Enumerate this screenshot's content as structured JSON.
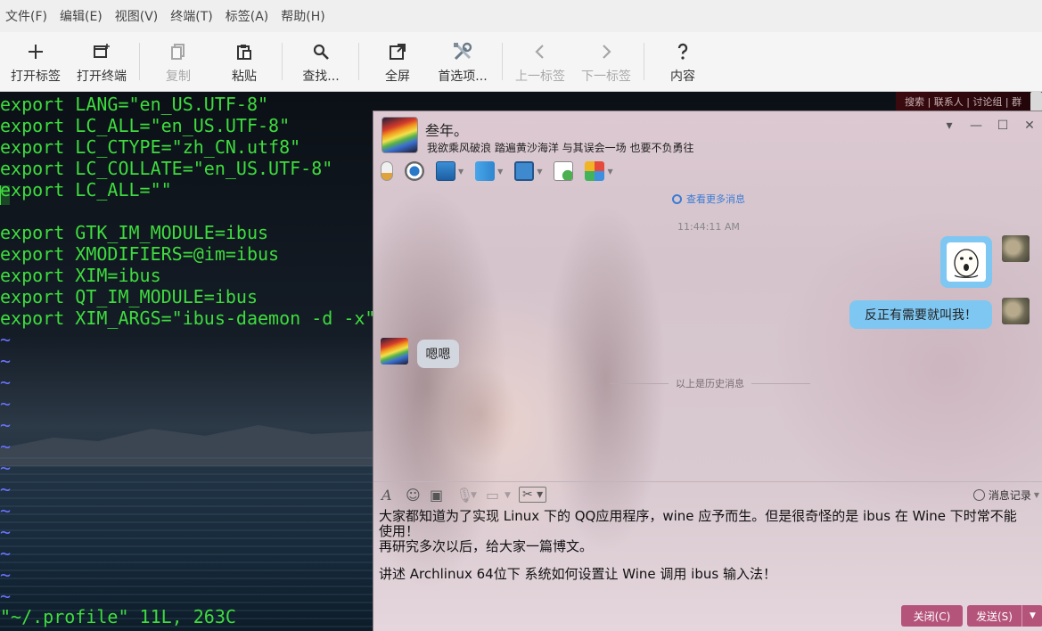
{
  "menubar": {
    "items": [
      "文件(F)",
      "编辑(E)",
      "视图(V)",
      "终端(T)",
      "标签(A)",
      "帮助(H)"
    ]
  },
  "toolbar": {
    "new_tab": "打开标签",
    "new_terminal": "打开终端",
    "copy": "复制",
    "paste": "粘贴",
    "find": "查找...",
    "fullscreen": "全屏",
    "preferences": "首选项...",
    "prev_tab": "上一标签",
    "next_tab": "下一标签",
    "contents": "内容"
  },
  "terminal": {
    "lines": [
      "export LANG=\"en_US.UTF-8\"",
      "export LC_ALL=\"en_US.UTF-8\"",
      "export LC_CTYPE=\"zh_CN.utf8\"",
      "export LC_COLLATE=\"en_US.UTF-8\"",
      "export LC_ALL=\"\"",
      "",
      "export GTK_IM_MODULE=ibus",
      "export XMODIFIERS=@im=ibus",
      "export XIM=ibus",
      "export QT_IM_MODULE=ibus",
      "export XIM_ARGS=\"ibus-daemon -d -x\""
    ],
    "empty_marker": "~",
    "empty_marker_count": 13,
    "status_line": "\"~/.profile\" 11L, 263C",
    "background_strip": "搜索 | 联系人 | 讨论组 | 群"
  },
  "chat": {
    "contact_name": "叁年。",
    "signature": "我欲乘风破浪 踏遍黄沙海洋 与其误会一场 也要不负勇往",
    "more_messages": "查看更多消息",
    "timestamp": "11:44:11 AM",
    "messages": [
      {
        "from": "me",
        "type": "sticker"
      },
      {
        "from": "me",
        "type": "text",
        "text": "反正有需要就叫我！"
      },
      {
        "from": "other",
        "type": "text",
        "text": "嗯嗯"
      }
    ],
    "history_divider": "以上是历史消息",
    "history_button": "消息记录",
    "input_lines": [
      "大家都知道为了实现 Linux 下的 QQ应用程序，wine 应予而生。但是很奇怪的是 ibus 在 Wine 下时常不能",
      "使用！",
      "再研究多次以后，给大家一篇博文。",
      "",
      "讲述 Archlinux 64位下 系统如何设置让 Wine 调用 ibus 输入法！"
    ],
    "close_button": "关闭(C)",
    "send_button": "发送(S)",
    "accent_color": "#b5547b",
    "bubble_me_color": "#7ec7f2"
  }
}
